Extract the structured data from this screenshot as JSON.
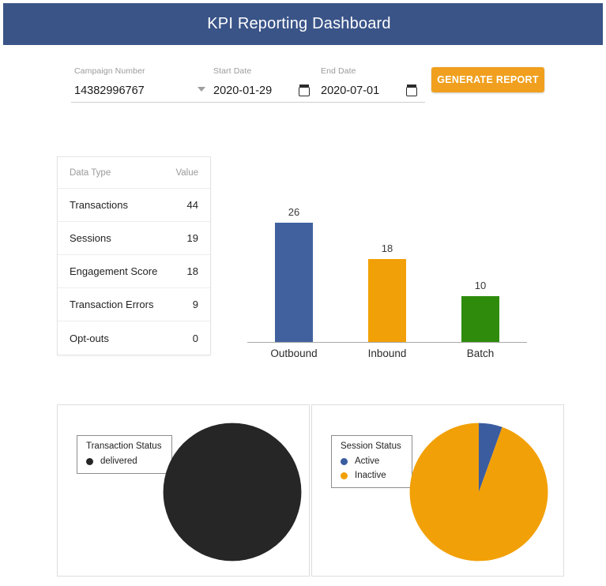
{
  "header": {
    "title": "KPI Reporting Dashboard",
    "bar_color": "#3a5488"
  },
  "filters": {
    "campaign": {
      "label": "Campaign Number",
      "value": "14382996767",
      "icon": "chevron-down-icon"
    },
    "start_date": {
      "label": "Start Date",
      "value": "2020-01-29",
      "placeholder": "yyyy-mm-dd",
      "icon": "calendar-icon"
    },
    "end_date": {
      "label": "End Date",
      "value": "2020-07-01",
      "placeholder": "yyyy-mm-dd",
      "icon": "calendar-icon"
    },
    "generate_button": {
      "label": "GENERATE REPORT",
      "color": "#f0a01e"
    }
  },
  "kpi_table": {
    "columns": [
      "Data Type",
      "Value"
    ],
    "rows": [
      {
        "label": "Transactions",
        "value": "44"
      },
      {
        "label": "Sessions",
        "value": "19"
      },
      {
        "label": "Engagement Score",
        "value": "18"
      },
      {
        "label": "Transaction Errors",
        "value": "9"
      },
      {
        "label": "Opt-outs",
        "value": "0"
      }
    ]
  },
  "chart_data": [
    {
      "type": "bar",
      "title": "",
      "xlabel": "",
      "ylabel": "",
      "categories": [
        "Outbound",
        "Inbound",
        "Batch"
      ],
      "values": [
        26,
        18,
        10
      ],
      "value_labels": [
        "26",
        "18",
        "10"
      ],
      "colors": [
        "#41619e",
        "#f2a007",
        "#2e8b0b"
      ],
      "ylim": [
        0,
        26
      ],
      "grid": false,
      "legend": "none",
      "axis_line_color": "#a8a8a8"
    },
    {
      "type": "pie",
      "title": "Transaction Status",
      "legend_position": "left",
      "labels": [
        "delivered"
      ],
      "values": [
        100
      ],
      "colors": [
        "#262626"
      ]
    },
    {
      "type": "pie",
      "title": "Session Status",
      "legend_position": "left",
      "labels": [
        "Active",
        "Inactive"
      ],
      "values": [
        5.5,
        94.5
      ],
      "colors": [
        "#3b5da0",
        "#f2a007"
      ]
    }
  ]
}
